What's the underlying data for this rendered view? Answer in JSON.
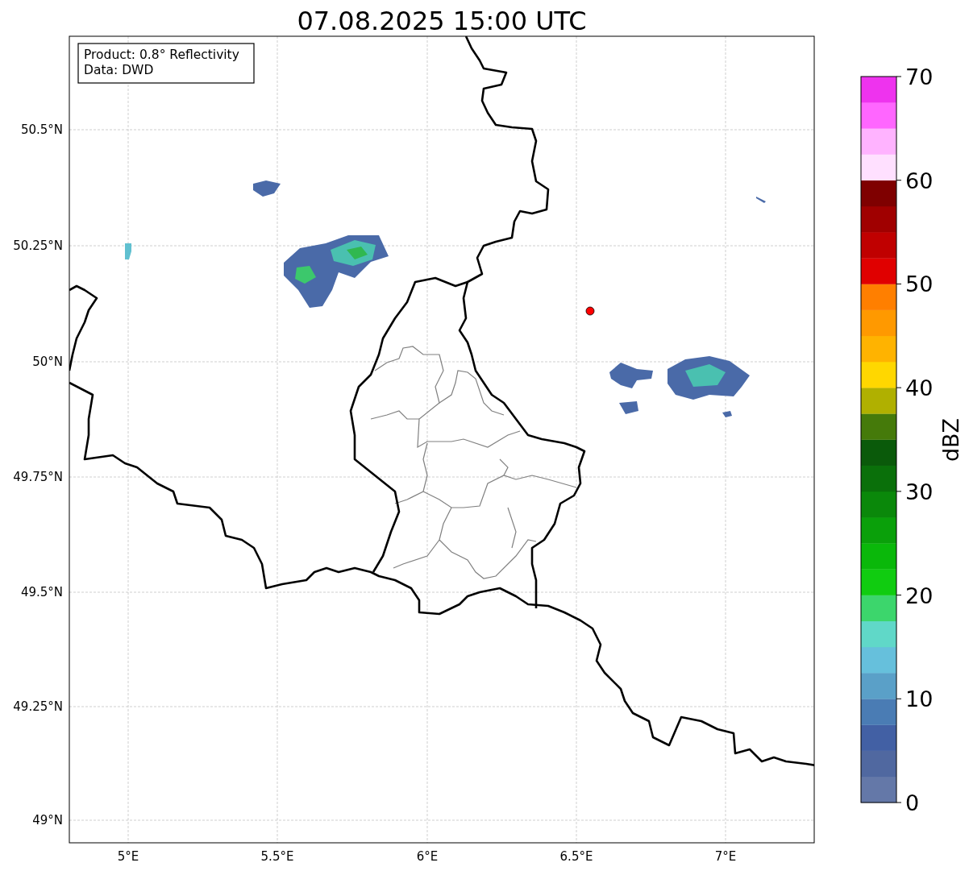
{
  "title": "07.08.2025 15:00 UTC",
  "info_box": {
    "lines": [
      "Product: 0.8° Reflectivity",
      "Data: DWD"
    ]
  },
  "map": {
    "lat_labels": [
      "50.5°N",
      "50.25°N",
      "50°N",
      "49.75°N",
      "49.5°N",
      "49.25°N",
      "49°N"
    ],
    "lon_labels": [
      "5°E",
      "5.5°E",
      "6°E",
      "6.5°E",
      "7°E"
    ]
  },
  "colorbar": {
    "label": "dBZ",
    "ticks": [
      "70",
      "60",
      "50",
      "40",
      "30",
      "20",
      "10",
      "0"
    ],
    "bins": [
      {
        "color": "#6478a8"
      },
      {
        "color": "#5068a0"
      },
      {
        "color": "#4260a4"
      },
      {
        "color": "#4a7cb4"
      },
      {
        "color": "#5aa0c8"
      },
      {
        "color": "#66c0dc"
      },
      {
        "color": "#60d8c8"
      },
      {
        "color": "#3cd66c"
      },
      {
        "color": "#10cc10"
      },
      {
        "color": "#0ab80a"
      },
      {
        "color": "#0aa00a"
      },
      {
        "color": "#0a880a"
      },
      {
        "color": "#0a700a"
      },
      {
        "color": "#0a5a0a"
      },
      {
        "color": "#457a0a"
      },
      {
        "color": "#b0b000"
      },
      {
        "color": "#ffd700"
      },
      {
        "color": "#ffb300"
      },
      {
        "color": "#ff9900"
      },
      {
        "color": "#ff7f00"
      },
      {
        "color": "#e00000"
      },
      {
        "color": "#c00000"
      },
      {
        "color": "#a00000"
      },
      {
        "color": "#7f0000"
      },
      {
        "color": "#ffe0ff"
      },
      {
        "color": "#ffb3ff"
      },
      {
        "color": "#ff66ff"
      },
      {
        "color": "#ee33ee"
      }
    ]
  }
}
